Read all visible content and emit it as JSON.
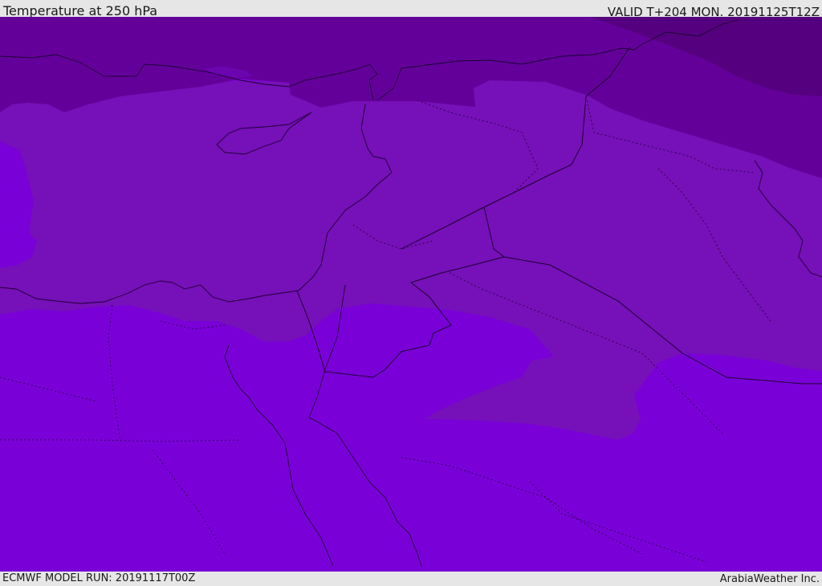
{
  "header": {
    "title": "Temperature at 250 hPa",
    "valid": "VALID T+204 MON. 20191125T12Z"
  },
  "footer": {
    "model_run": "ECMWF MODEL RUN: 20191117T00Z",
    "credit": "ArabiaWeather Inc."
  },
  "colors": {
    "band_warm": "#7a00d8",
    "band_mid": "#7610b8",
    "band_cool": "#64009a",
    "band_cold": "#55007e",
    "background": "#e6e6e6"
  }
}
